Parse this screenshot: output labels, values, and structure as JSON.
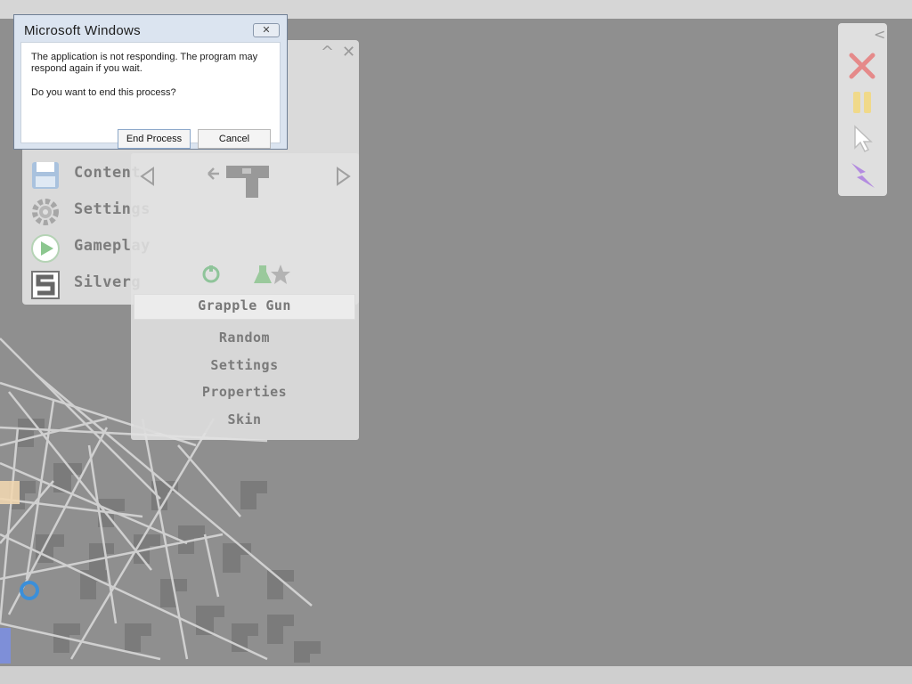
{
  "dialog": {
    "title": "Microsoft Windows",
    "close_glyph": "✕",
    "message": "The application is not responding. The program may respond again if you wait.",
    "question": "Do you want to end this process?",
    "end_process_label": "End Process",
    "cancel_label": "Cancel"
  },
  "main_menu": {
    "controls": {
      "collapse": "^",
      "close": "✕"
    },
    "items": [
      {
        "label": "Content",
        "icon": "floppy-disk-icon"
      },
      {
        "label": "Settings",
        "icon": "gear-icon"
      },
      {
        "label": "Gameplay",
        "icon": "play-icon"
      },
      {
        "label": "Silverg",
        "icon": "silvergun-logo-icon"
      }
    ]
  },
  "weapon_panel": {
    "weapon_name": "Grapple Gun",
    "weapon_icon": "grapple-gun-icon",
    "options": [
      "Random",
      "Settings",
      "Properties",
      "Skin"
    ]
  },
  "toolbar": {
    "collapse": "<",
    "buttons": [
      "close-x-icon",
      "pause-icon",
      "cursor-icon",
      "lightning-icon"
    ]
  },
  "colors": {
    "dialog_frame": "#dbe4f0",
    "background": "#8f8f8f",
    "close_x": "#e58a8a",
    "pause": "#f0d98a",
    "lightning": "#b38be0"
  }
}
